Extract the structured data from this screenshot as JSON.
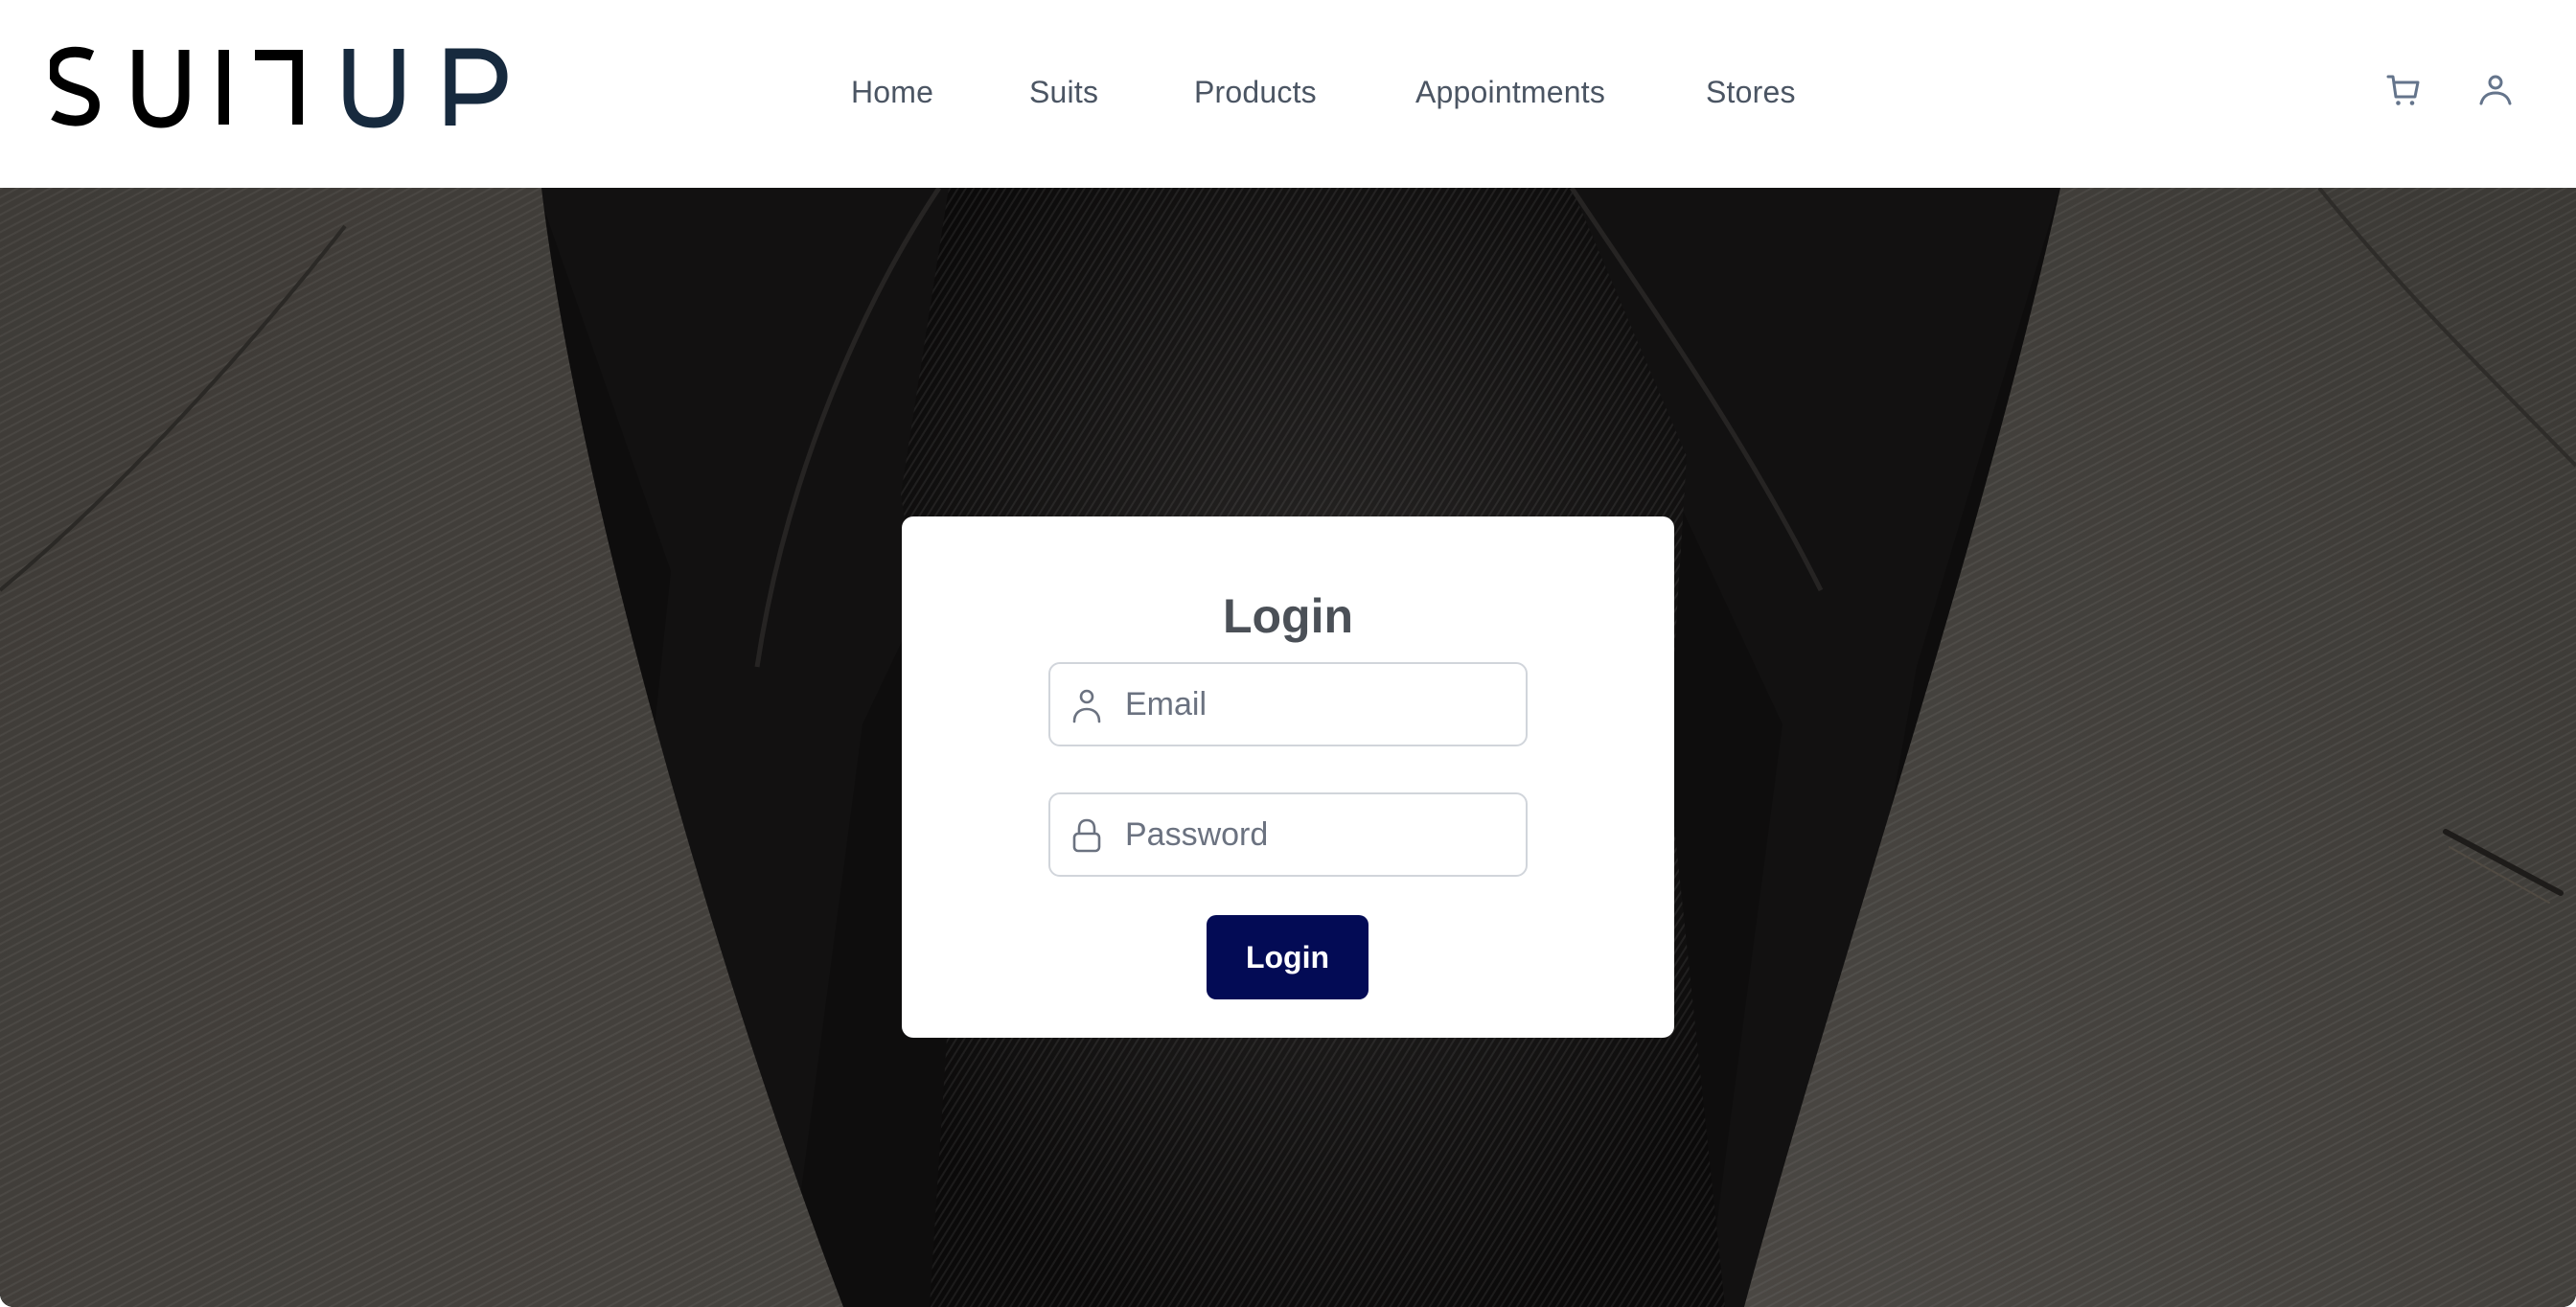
{
  "brand": {
    "logo_text": "SUITUP",
    "logo_part_dark": "SUIT",
    "logo_part_accent": "UP",
    "colors": {
      "logo_dark": "#000000",
      "logo_accent": "#172a3e"
    }
  },
  "nav": {
    "items": [
      {
        "label": "Home"
      },
      {
        "label": "Suits"
      },
      {
        "label": "Products"
      },
      {
        "label": "Appointments"
      },
      {
        "label": "Stores"
      }
    ]
  },
  "header_actions": {
    "cart_icon": "shopping-cart-icon",
    "user_icon": "user-icon"
  },
  "hero": {
    "background_description": "close-up of charcoal suit jacket lapels with black shirt collar and black silk tie"
  },
  "login": {
    "title": "Login",
    "email": {
      "icon": "user-icon",
      "placeholder": "Email",
      "value": ""
    },
    "password": {
      "icon": "lock-icon",
      "placeholder": "Password",
      "value": ""
    },
    "submit_label": "Login"
  },
  "theme": {
    "primary_button": "#030b55",
    "nav_text": "#4b5563",
    "icon_color": "#64748b",
    "title_text": "#4b5057",
    "placeholder_text": "#6b7280",
    "input_border": "#d1d5db"
  }
}
